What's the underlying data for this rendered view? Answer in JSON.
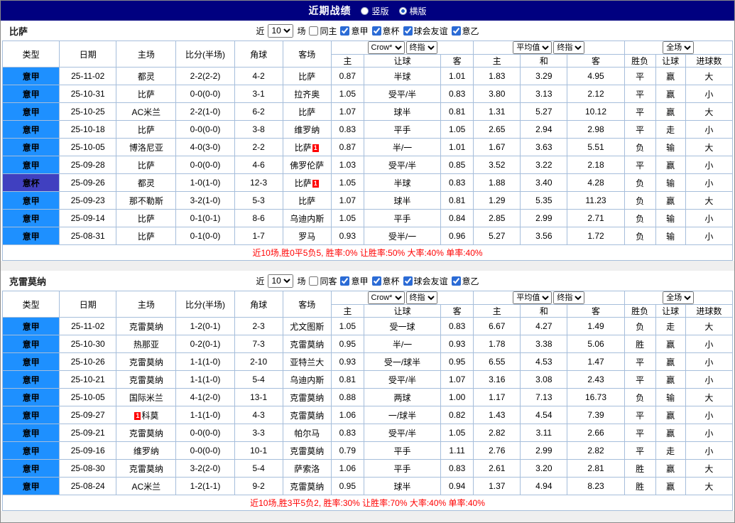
{
  "topbar": {
    "title": "近期战绩",
    "vertical_label": "竖版",
    "horizontal_label": "横版",
    "selected": "横版"
  },
  "table_header": {
    "left_cols": [
      "类型",
      "日期",
      "主场",
      "比分(半场)",
      "角球",
      "客场"
    ],
    "odds_selects": [
      "Crow*",
      "终指"
    ],
    "avg_selects": [
      "平均值",
      "终指"
    ],
    "fullmatch_select": "全场",
    "sub_cols": [
      "主",
      "让球",
      "客",
      "主",
      "和",
      "客",
      "胜负",
      "让球",
      "进球数"
    ]
  },
  "colors": {
    "topbar_bg": "#000080",
    "league_badge": "#1e90ff",
    "cup_badge": "#4040c0",
    "focus_team": "#008000",
    "score": "#ff0000",
    "odds": "#00008b",
    "red": "#ff0000",
    "green": "#008000",
    "blue": "#0000ee"
  },
  "tables": [
    {
      "team": "比萨",
      "filter": {
        "prefix": "近",
        "count": "10",
        "suffix": "场",
        "checkboxes": [
          {
            "label": "同主",
            "checked": false
          },
          {
            "label": "意甲",
            "checked": true
          },
          {
            "label": "意杯",
            "checked": true
          },
          {
            "label": "球会友谊",
            "checked": true
          },
          {
            "label": "意乙",
            "checked": true
          }
        ]
      },
      "rows": [
        {
          "league": "意甲",
          "cup": false,
          "date": "25-11-02",
          "home": "都灵",
          "home_focus": false,
          "home_card": "",
          "score": "2-2(2-2)",
          "corners": "4-2",
          "away": "比萨",
          "away_focus": true,
          "away_card": "",
          "home_odds": "0.87",
          "handicap": "半球",
          "away_odds": "1.01",
          "avg_home": "1.83",
          "avg_draw": "3.29",
          "avg_away": "4.95",
          "result": "平",
          "result_color": "green",
          "handicap_result": "赢",
          "handicap_result_color": "red",
          "goals": "大",
          "goals_color": "red"
        },
        {
          "league": "意甲",
          "cup": false,
          "date": "25-10-31",
          "home": "比萨",
          "home_focus": true,
          "home_card": "",
          "score": "0-0(0-0)",
          "corners": "3-1",
          "away": "拉齐奥",
          "away_focus": false,
          "away_card": "",
          "home_odds": "1.05",
          "handicap": "受平/半",
          "away_odds": "0.83",
          "avg_home": "3.80",
          "avg_draw": "3.13",
          "avg_away": "2.12",
          "result": "平",
          "result_color": "green",
          "handicap_result": "赢",
          "handicap_result_color": "red",
          "goals": "小",
          "goals_color": "green"
        },
        {
          "league": "意甲",
          "cup": false,
          "date": "25-10-25",
          "home": "AC米兰",
          "home_focus": false,
          "home_card": "",
          "score": "2-2(1-0)",
          "corners": "6-2",
          "away": "比萨",
          "away_focus": true,
          "away_card": "",
          "home_odds": "1.07",
          "handicap": "球半",
          "away_odds": "0.81",
          "avg_home": "1.31",
          "avg_draw": "5.27",
          "avg_away": "10.12",
          "result": "平",
          "result_color": "green",
          "handicap_result": "赢",
          "handicap_result_color": "red",
          "goals": "大",
          "goals_color": "red"
        },
        {
          "league": "意甲",
          "cup": false,
          "date": "25-10-18",
          "home": "比萨",
          "home_focus": true,
          "home_card": "",
          "score": "0-0(0-0)",
          "corners": "3-8",
          "away": "维罗纳",
          "away_focus": false,
          "away_card": "",
          "home_odds": "0.83",
          "handicap": "平手",
          "away_odds": "1.05",
          "avg_home": "2.65",
          "avg_draw": "2.94",
          "avg_away": "2.98",
          "result": "平",
          "result_color": "green",
          "handicap_result": "走",
          "handicap_result_color": "green",
          "goals": "小",
          "goals_color": "green"
        },
        {
          "league": "意甲",
          "cup": false,
          "date": "25-10-05",
          "home": "博洛尼亚",
          "home_focus": false,
          "home_card": "",
          "score": "4-0(3-0)",
          "corners": "2-2",
          "away": "比萨",
          "away_focus": true,
          "away_card": "1",
          "home_odds": "0.87",
          "handicap": "半/一",
          "away_odds": "1.01",
          "avg_home": "1.67",
          "avg_draw": "3.63",
          "avg_away": "5.51",
          "result": "负",
          "result_color": "red",
          "handicap_result": "输",
          "handicap_result_color": "blue",
          "goals": "大",
          "goals_color": "red"
        },
        {
          "league": "意甲",
          "cup": false,
          "date": "25-09-28",
          "home": "比萨",
          "home_focus": true,
          "home_card": "",
          "score": "0-0(0-0)",
          "corners": "4-6",
          "away": "佛罗伦萨",
          "away_focus": false,
          "away_card": "",
          "home_odds": "1.03",
          "handicap": "受平/半",
          "away_odds": "0.85",
          "avg_home": "3.52",
          "avg_draw": "3.22",
          "avg_away": "2.18",
          "result": "平",
          "result_color": "green",
          "handicap_result": "赢",
          "handicap_result_color": "red",
          "goals": "小",
          "goals_color": "green"
        },
        {
          "league": "意杯",
          "cup": true,
          "date": "25-09-26",
          "home": "都灵",
          "home_focus": false,
          "home_card": "",
          "score": "1-0(1-0)",
          "corners": "12-3",
          "away": "比萨",
          "away_focus": true,
          "away_card": "1",
          "home_odds": "1.05",
          "handicap": "半球",
          "away_odds": "0.83",
          "avg_home": "1.88",
          "avg_draw": "3.40",
          "avg_away": "4.28",
          "result": "负",
          "result_color": "red",
          "handicap_result": "输",
          "handicap_result_color": "blue",
          "goals": "小",
          "goals_color": "green"
        },
        {
          "league": "意甲",
          "cup": false,
          "date": "25-09-23",
          "home": "那不勒斯",
          "home_focus": false,
          "home_card": "",
          "score": "3-2(1-0)",
          "corners": "5-3",
          "away": "比萨",
          "away_focus": true,
          "away_card": "",
          "home_odds": "1.07",
          "handicap": "球半",
          "away_odds": "0.81",
          "avg_home": "1.29",
          "avg_draw": "5.35",
          "avg_away": "11.23",
          "result": "负",
          "result_color": "red",
          "handicap_result": "赢",
          "handicap_result_color": "red",
          "goals": "大",
          "goals_color": "red"
        },
        {
          "league": "意甲",
          "cup": false,
          "date": "25-09-14",
          "home": "比萨",
          "home_focus": true,
          "home_card": "",
          "score": "0-1(0-1)",
          "corners": "8-6",
          "away": "乌迪内斯",
          "away_focus": false,
          "away_card": "",
          "home_odds": "1.05",
          "handicap": "平手",
          "away_odds": "0.84",
          "avg_home": "2.85",
          "avg_draw": "2.99",
          "avg_away": "2.71",
          "result": "负",
          "result_color": "red",
          "handicap_result": "输",
          "handicap_result_color": "blue",
          "goals": "小",
          "goals_color": "green"
        },
        {
          "league": "意甲",
          "cup": false,
          "date": "25-08-31",
          "home": "比萨",
          "home_focus": true,
          "home_card": "",
          "score": "0-1(0-0)",
          "corners": "1-7",
          "away": "罗马",
          "away_focus": false,
          "away_card": "",
          "home_odds": "0.93",
          "handicap": "受半/一",
          "away_odds": "0.96",
          "avg_home": "5.27",
          "avg_draw": "3.56",
          "avg_away": "1.72",
          "result": "负",
          "result_color": "red",
          "handicap_result": "输",
          "handicap_result_color": "blue",
          "goals": "小",
          "goals_color": "green"
        }
      ],
      "summary": "近10场,胜0平5负5, 胜率:0% 让胜率:50% 大率:40% 单率:40%"
    },
    {
      "team": "克雷莫纳",
      "filter": {
        "prefix": "近",
        "count": "10",
        "suffix": "场",
        "checkboxes": [
          {
            "label": "同客",
            "checked": false
          },
          {
            "label": "意甲",
            "checked": true
          },
          {
            "label": "意杯",
            "checked": true
          },
          {
            "label": "球会友谊",
            "checked": true
          },
          {
            "label": "意乙",
            "checked": true
          }
        ]
      },
      "rows": [
        {
          "league": "意甲",
          "cup": false,
          "date": "25-11-02",
          "home": "克雷莫纳",
          "home_focus": true,
          "home_card": "",
          "score": "1-2(0-1)",
          "corners": "2-3",
          "away": "尤文图斯",
          "away_focus": false,
          "away_card": "",
          "home_odds": "1.05",
          "handicap": "受一球",
          "away_odds": "0.83",
          "avg_home": "6.67",
          "avg_draw": "4.27",
          "avg_away": "1.49",
          "result": "负",
          "result_color": "red",
          "handicap_result": "走",
          "handicap_result_color": "green",
          "goals": "大",
          "goals_color": "red"
        },
        {
          "league": "意甲",
          "cup": false,
          "date": "25-10-30",
          "home": "热那亚",
          "home_focus": false,
          "home_card": "",
          "score": "0-2(0-1)",
          "corners": "7-3",
          "away": "克雷莫纳",
          "away_focus": true,
          "away_card": "",
          "home_odds": "0.95",
          "handicap": "半/一",
          "away_odds": "0.93",
          "avg_home": "1.78",
          "avg_draw": "3.38",
          "avg_away": "5.06",
          "result": "胜",
          "result_color": "red",
          "handicap_result": "赢",
          "handicap_result_color": "red",
          "goals": "小",
          "goals_color": "green"
        },
        {
          "league": "意甲",
          "cup": false,
          "date": "25-10-26",
          "home": "克雷莫纳",
          "home_focus": true,
          "home_card": "",
          "score": "1-1(1-0)",
          "corners": "2-10",
          "away": "亚特兰大",
          "away_focus": false,
          "away_card": "",
          "home_odds": "0.93",
          "handicap": "受一/球半",
          "away_odds": "0.95",
          "avg_home": "6.55",
          "avg_draw": "4.53",
          "avg_away": "1.47",
          "result": "平",
          "result_color": "green",
          "handicap_result": "赢",
          "handicap_result_color": "red",
          "goals": "小",
          "goals_color": "green"
        },
        {
          "league": "意甲",
          "cup": false,
          "date": "25-10-21",
          "home": "克雷莫纳",
          "home_focus": true,
          "home_card": "",
          "score": "1-1(1-0)",
          "corners": "5-4",
          "away": "乌迪内斯",
          "away_focus": false,
          "away_card": "",
          "home_odds": "0.81",
          "handicap": "受平/半",
          "away_odds": "1.07",
          "avg_home": "3.16",
          "avg_draw": "3.08",
          "avg_away": "2.43",
          "result": "平",
          "result_color": "green",
          "handicap_result": "赢",
          "handicap_result_color": "red",
          "goals": "小",
          "goals_color": "green"
        },
        {
          "league": "意甲",
          "cup": false,
          "date": "25-10-05",
          "home": "国际米兰",
          "home_focus": false,
          "home_card": "",
          "score": "4-1(2-0)",
          "corners": "13-1",
          "away": "克雷莫纳",
          "away_focus": true,
          "away_card": "",
          "home_odds": "0.88",
          "handicap": "两球",
          "away_odds": "1.00",
          "avg_home": "1.17",
          "avg_draw": "7.13",
          "avg_away": "16.73",
          "result": "负",
          "result_color": "red",
          "handicap_result": "输",
          "handicap_result_color": "blue",
          "goals": "大",
          "goals_color": "red"
        },
        {
          "league": "意甲",
          "cup": false,
          "date": "25-09-27",
          "home": "科莫",
          "home_focus": false,
          "home_card": "1",
          "score": "1-1(1-0)",
          "corners": "4-3",
          "away": "克雷莫纳",
          "away_focus": true,
          "away_card": "",
          "home_odds": "1.06",
          "handicap": "一/球半",
          "away_odds": "0.82",
          "avg_home": "1.43",
          "avg_draw": "4.54",
          "avg_away": "7.39",
          "result": "平",
          "result_color": "green",
          "handicap_result": "赢",
          "handicap_result_color": "red",
          "goals": "小",
          "goals_color": "green"
        },
        {
          "league": "意甲",
          "cup": false,
          "date": "25-09-21",
          "home": "克雷莫纳",
          "home_focus": true,
          "home_card": "",
          "score": "0-0(0-0)",
          "corners": "3-3",
          "away": "帕尔马",
          "away_focus": false,
          "away_card": "",
          "home_odds": "0.83",
          "handicap": "受平/半",
          "away_odds": "1.05",
          "avg_home": "2.82",
          "avg_draw": "3.11",
          "avg_away": "2.66",
          "result": "平",
          "result_color": "green",
          "handicap_result": "赢",
          "handicap_result_color": "red",
          "goals": "小",
          "goals_color": "green"
        },
        {
          "league": "意甲",
          "cup": false,
          "date": "25-09-16",
          "home": "维罗纳",
          "home_focus": false,
          "home_card": "",
          "score": "0-0(0-0)",
          "corners": "10-1",
          "away": "克雷莫纳",
          "away_focus": true,
          "away_card": "",
          "home_odds": "0.79",
          "handicap": "平手",
          "away_odds": "1.11",
          "avg_home": "2.76",
          "avg_draw": "2.99",
          "avg_away": "2.82",
          "result": "平",
          "result_color": "green",
          "handicap_result": "走",
          "handicap_result_color": "green",
          "goals": "小",
          "goals_color": "green"
        },
        {
          "league": "意甲",
          "cup": false,
          "date": "25-08-30",
          "home": "克雷莫纳",
          "home_focus": true,
          "home_card": "",
          "score": "3-2(2-0)",
          "corners": "5-4",
          "away": "萨索洛",
          "away_focus": false,
          "away_card": "",
          "home_odds": "1.06",
          "handicap": "平手",
          "away_odds": "0.83",
          "avg_home": "2.61",
          "avg_draw": "3.20",
          "avg_away": "2.81",
          "result": "胜",
          "result_color": "red",
          "handicap_result": "赢",
          "handicap_result_color": "red",
          "goals": "大",
          "goals_color": "red"
        },
        {
          "league": "意甲",
          "cup": false,
          "date": "25-08-24",
          "home": "AC米兰",
          "home_focus": false,
          "home_card": "",
          "score": "1-2(1-1)",
          "corners": "9-2",
          "away": "克雷莫纳",
          "away_focus": true,
          "away_card": "",
          "home_odds": "0.95",
          "handicap": "球半",
          "away_odds": "0.94",
          "avg_home": "1.37",
          "avg_draw": "4.94",
          "avg_away": "8.23",
          "result": "胜",
          "result_color": "red",
          "handicap_result": "赢",
          "handicap_result_color": "red",
          "goals": "大",
          "goals_color": "red"
        }
      ],
      "summary": "近10场,胜3平5负2, 胜率:30% 让胜率:70% 大率:40% 单率:40%"
    }
  ]
}
